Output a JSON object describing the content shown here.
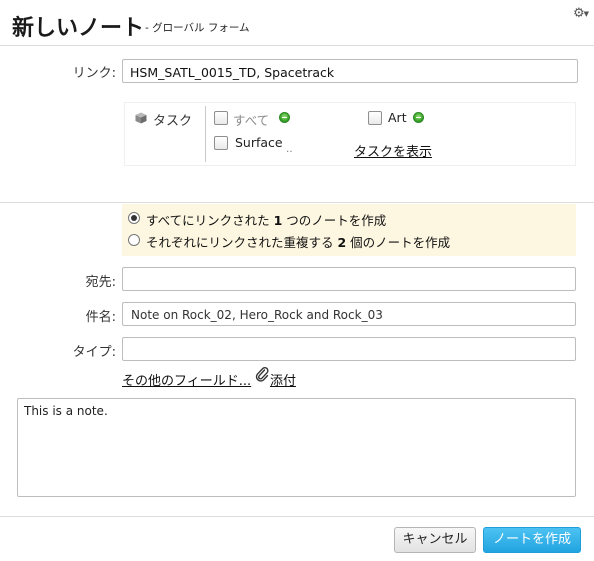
{
  "header": {
    "title": "新しいノート",
    "subtitle": "- グローバル フォーム",
    "gear_icon": "gear-icon"
  },
  "link": {
    "label": "リンク:",
    "value": "HSM_SATL_0015_TD, Spacetrack"
  },
  "tasks": {
    "heading": "タスク",
    "heading_icon": "cube-icon",
    "items": [
      {
        "label": "すべて",
        "checked": false,
        "status_icon": "green-status-icon"
      },
      {
        "label": "Art",
        "checked": false,
        "status_icon": "green-status-icon"
      },
      {
        "label": "Surface",
        "checked": false,
        "extra": "‥"
      }
    ],
    "show_tasks_link": "タスクを表示"
  },
  "link_mode": {
    "options": [
      {
        "prefix": "すべてにリンクされた ",
        "count": "1",
        "suffix": " つのノートを作成",
        "selected": true
      },
      {
        "prefix": "それぞれにリンクされた重複する ",
        "count": "2",
        "suffix": " 個のノートを作成",
        "selected": false
      }
    ]
  },
  "fields": {
    "to_label": "宛先:",
    "to_value": "",
    "subject_label": "件名:",
    "subject_value": "Note on Rock_02, Hero_Rock and Rock_03",
    "type_label": "タイプ:",
    "type_value": ""
  },
  "links": {
    "more_fields": "その他のフィールド...",
    "attach": "添付",
    "attach_icon": "paperclip-icon"
  },
  "body": {
    "text": "This is a note."
  },
  "buttons": {
    "cancel": "キャンセル",
    "create": "ノートを作成"
  },
  "colors": {
    "primary_button": "#22a4e0",
    "highlight_bg": "#fdf6e1",
    "status_green": "#3aa52c"
  }
}
